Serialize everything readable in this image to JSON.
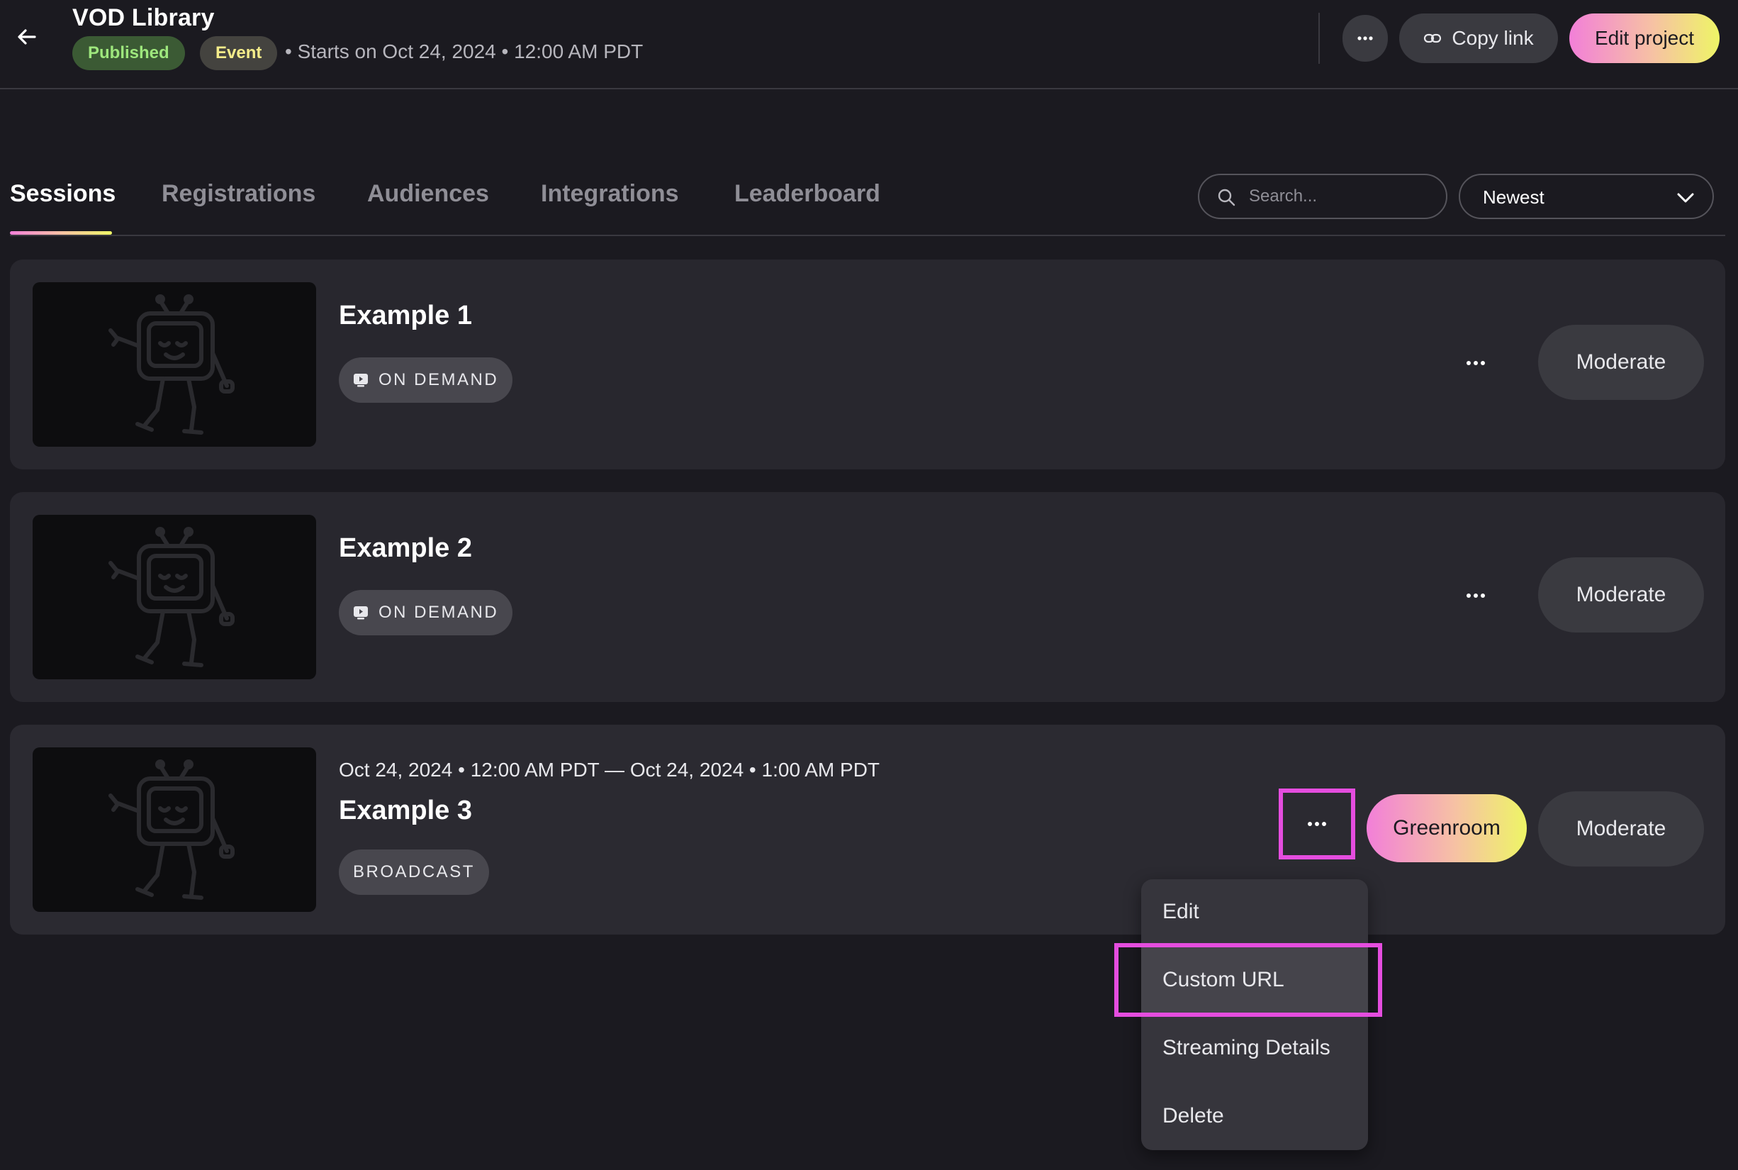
{
  "header": {
    "title": "VOD Library",
    "status_badge": "Published",
    "type_badge": "Event",
    "starts_text": "• Starts on Oct 24, 2024 • 12:00 AM PDT",
    "copy_link_label": "Copy link",
    "edit_project_label": "Edit project"
  },
  "tabs": [
    {
      "label": "Sessions",
      "active": true
    },
    {
      "label": "Registrations",
      "active": false
    },
    {
      "label": "Audiences",
      "active": false
    },
    {
      "label": "Integrations",
      "active": false
    },
    {
      "label": "Leaderboard",
      "active": false
    }
  ],
  "search": {
    "placeholder": "Search..."
  },
  "sort": {
    "selected": "Newest"
  },
  "sessions": [
    {
      "title": "Example 1",
      "badge": "ON DEMAND",
      "moderate_label": "Moderate"
    },
    {
      "title": "Example 2",
      "badge": "ON DEMAND",
      "moderate_label": "Moderate"
    },
    {
      "date": "Oct 24, 2024 • 12:00 AM PDT — Oct 24, 2024 • 1:00 AM PDT",
      "title": "Example 3",
      "badge": "BROADCAST",
      "greenroom_label": "Greenroom",
      "moderate_label": "Moderate"
    }
  ],
  "context_menu": {
    "items": [
      "Edit",
      "Custom URL",
      "Streaming Details",
      "Delete"
    ]
  },
  "colors": {
    "background": "#1b1a20",
    "card": "#28272e",
    "accent_gradient_start": "#f27fd8",
    "accent_gradient_end": "#eef566",
    "highlight_outline": "#e54ddf",
    "published_green": "#9ee77d",
    "event_yellow": "#f4ec8a"
  },
  "icons": {
    "back": "arrow-left-icon",
    "more": "ellipsis-icon",
    "link": "link-icon",
    "search": "search-icon",
    "chevron": "chevron-down-icon",
    "on_demand": "play-screen-icon",
    "thumbnail": "robot-tv-mascot"
  }
}
